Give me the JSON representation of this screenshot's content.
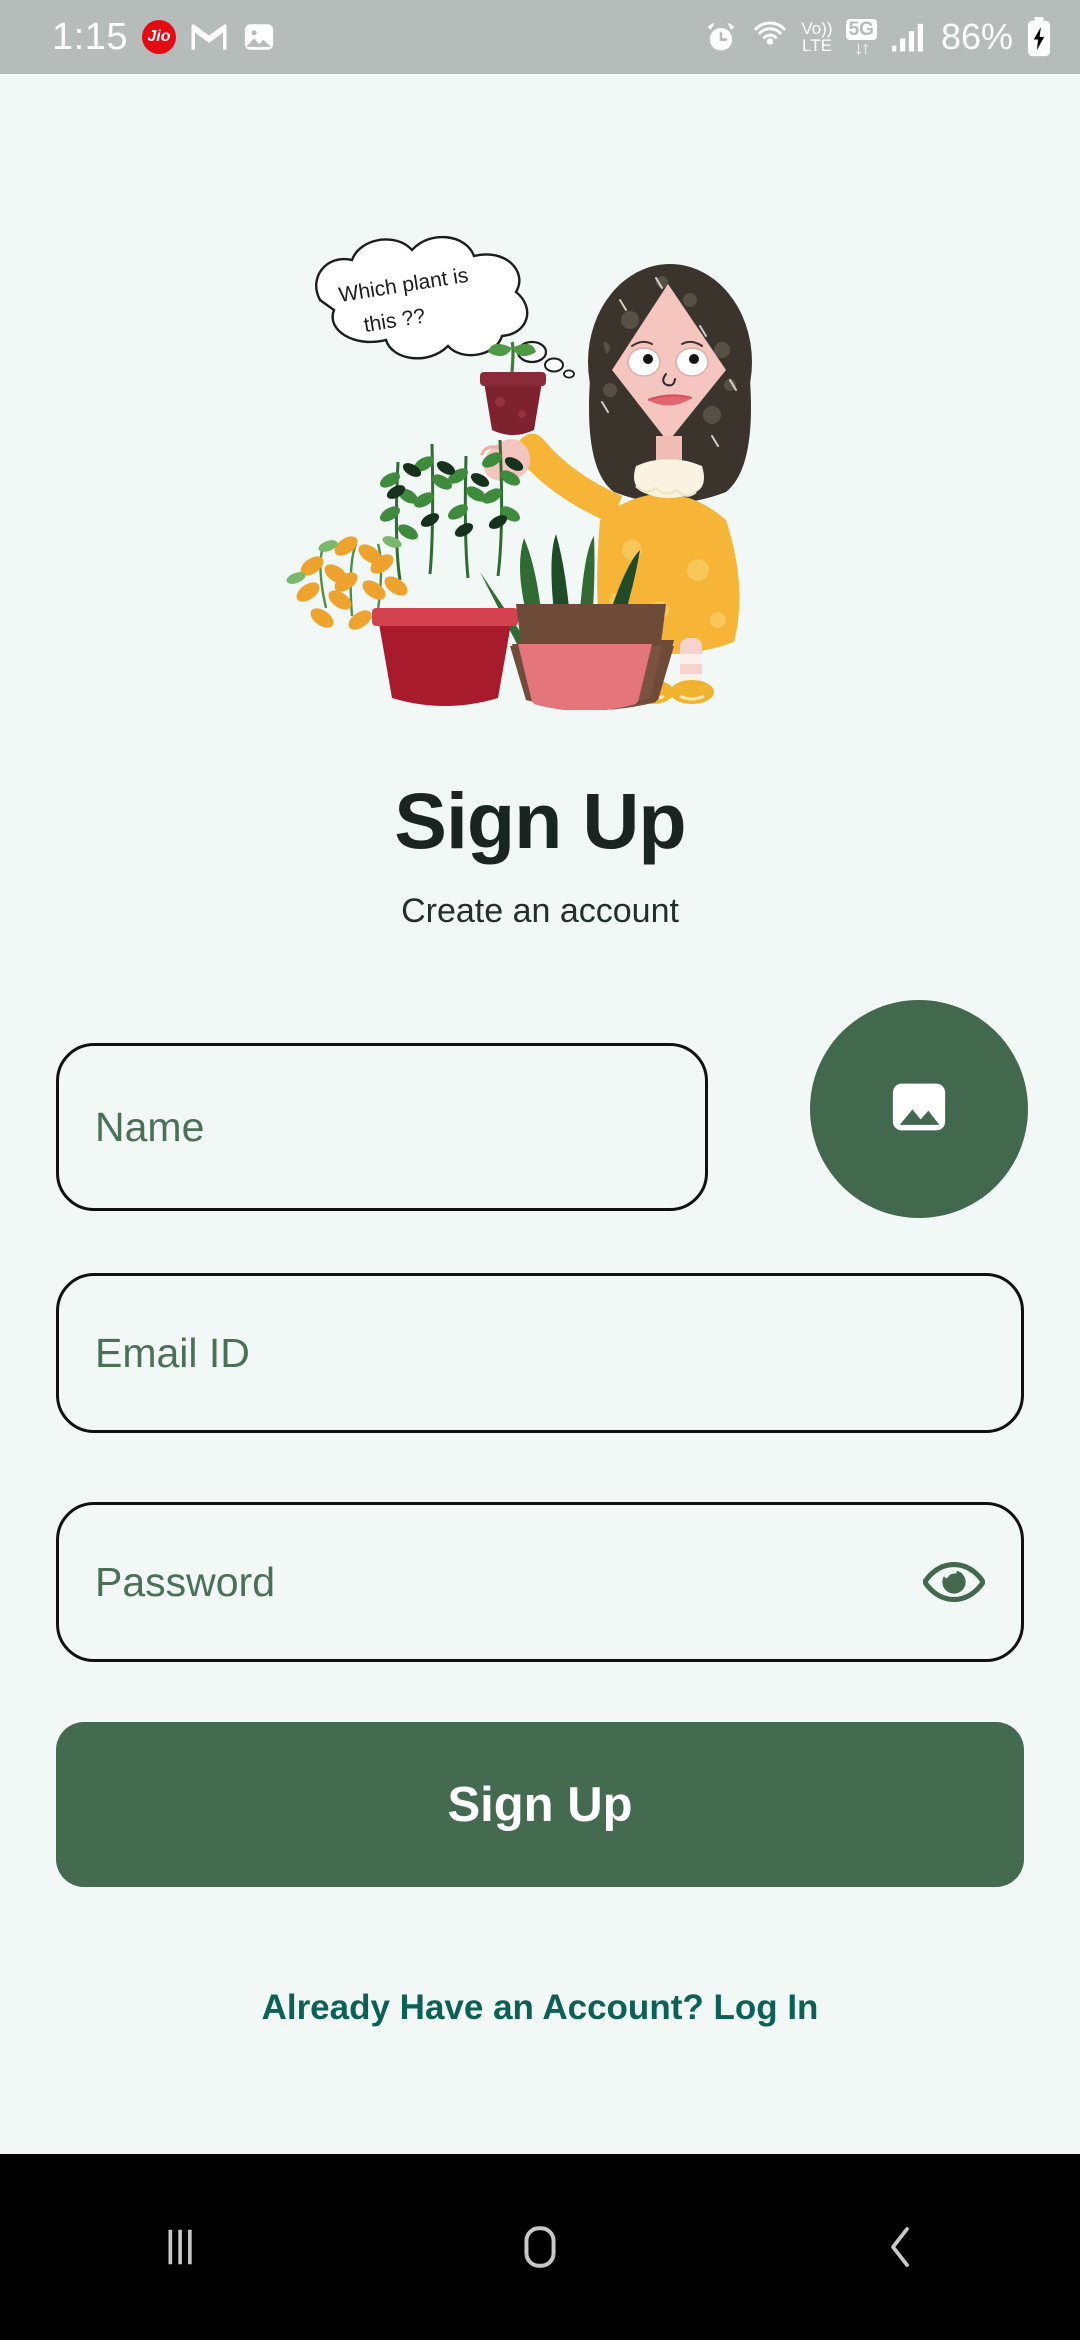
{
  "status_bar": {
    "time": "1:15",
    "carrier_badge": "Jio",
    "icons_left": [
      "jio-badge-icon",
      "gmail-icon",
      "photos-icon"
    ],
    "alarm_icon": "alarm-clock-icon",
    "hotspot_icon": "hotspot-icon",
    "volte_line1": "Vo))",
    "volte_line2": "LTE",
    "network_label": "5G",
    "network_arrows": "↓↑",
    "signal_icon": "signal-bars-icon",
    "battery_percent": "86%",
    "battery_icon": "battery-charging-icon",
    "background_color": "#b6bcba"
  },
  "illustration": {
    "name": "girl-with-plants-illustration",
    "thought_line1": "Which plant is",
    "thought_line2": "this ??",
    "colors": {
      "hair": "#3a342c",
      "skin": "#f2c4bd",
      "dress": "#f6b537",
      "pot_red": "#b32436",
      "pot_brown": "#6e4a38",
      "pot_pink": "#e4757a",
      "leaf_dark": "#1f3d24",
      "leaf_green": "#4b8b44",
      "leaf_orange": "#eda32e"
    }
  },
  "header": {
    "title": "Sign Up",
    "subtitle": "Create an account"
  },
  "form": {
    "name": {
      "placeholder": "Name",
      "value": ""
    },
    "email": {
      "placeholder": "Email ID",
      "value": ""
    },
    "password": {
      "placeholder": "Password",
      "value": "",
      "toggle_icon": "eye-icon"
    },
    "avatar_button": {
      "icon": "image-picker-icon"
    },
    "submit_label": "Sign Up",
    "login_link": "Already Have an Account? Log In"
  },
  "theme": {
    "background": "#f2f8f5",
    "accent_green": "#446a50",
    "avatar_green": "#42694d",
    "placeholder_green": "#4a7158",
    "link_teal": "#0c6156",
    "border_dark": "#111111"
  },
  "nav_bar": {
    "recents": "recents-icon",
    "home": "home-icon",
    "back": "back-icon",
    "background_color": "#000000"
  }
}
